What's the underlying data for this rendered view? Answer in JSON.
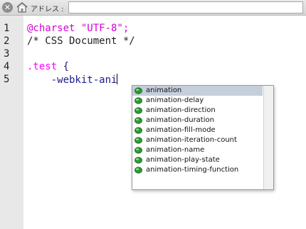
{
  "toolbar": {
    "stop_icon": "close-circle-icon",
    "home_icon": "home-icon",
    "address_label": "アドレス :",
    "address_value": ""
  },
  "editor": {
    "line_numbers": [
      "1",
      "2",
      "3",
      "4",
      "5"
    ],
    "lines": [
      {
        "kw": "@charset \"UTF-8\";"
      },
      {
        "cmt": "/* CSS Document */"
      },
      {},
      {
        "sel": ".test",
        "punc": " {"
      },
      {
        "indent": "    ",
        "prop": "-webkit-ani"
      }
    ]
  },
  "autocomplete": {
    "icon": "css-property-icon",
    "selected_index": 0,
    "items": [
      "animation",
      "animation-delay",
      "animation-direction",
      "animation-duration",
      "animation-fill-mode",
      "animation-iteration-count",
      "animation-name",
      "animation-play-state",
      "animation-timing-function"
    ]
  },
  "colors": {
    "at_rule": "#d600d6",
    "selector": "#ff00ff",
    "property": "#1a1a8e",
    "selected_row": "#c5cedb"
  }
}
